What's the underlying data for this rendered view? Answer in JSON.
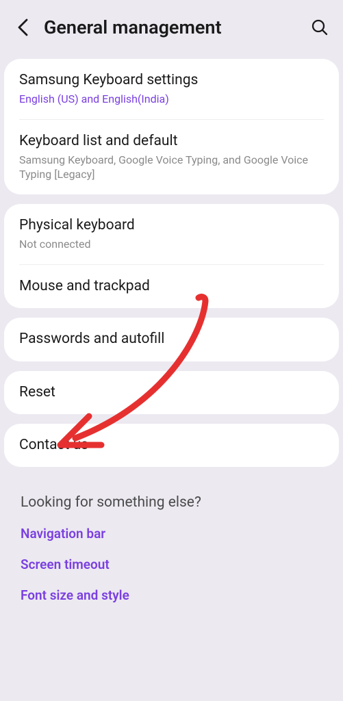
{
  "header": {
    "title": "General management"
  },
  "group1": {
    "samsung_keyboard": {
      "title": "Samsung Keyboard settings",
      "subtitle": "English (US) and English(India)"
    },
    "keyboard_list": {
      "title": "Keyboard list and default",
      "subtitle": "Samsung Keyboard, Google Voice Typing, and Google Voice Typing [Legacy]"
    }
  },
  "group2": {
    "physical_keyboard": {
      "title": "Physical keyboard",
      "subtitle": "Not connected"
    },
    "mouse_trackpad": {
      "title": "Mouse and trackpad"
    }
  },
  "group3": {
    "passwords_autofill": {
      "title": "Passwords and autofill"
    }
  },
  "group4": {
    "reset": {
      "title": "Reset"
    }
  },
  "group5": {
    "contact": {
      "title": "Contact us"
    }
  },
  "footer": {
    "heading": "Looking for something else?",
    "links": {
      "nav_bar": "Navigation bar",
      "screen_timeout": "Screen timeout",
      "font_size_style": "Font size and style"
    }
  }
}
